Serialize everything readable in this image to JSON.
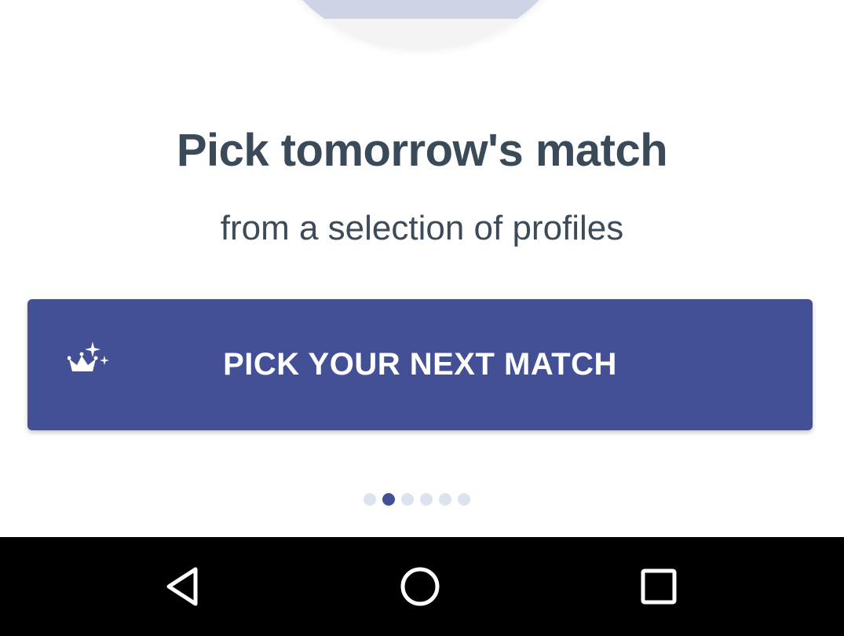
{
  "onboarding": {
    "title": "Pick tomorrow's match",
    "subtitle": "from a selection of profiles",
    "cta": {
      "label": "PICK YOUR NEXT MATCH",
      "icon": "crown-sparkle-icon"
    },
    "pagination": {
      "total": 6,
      "active_index": 1
    }
  },
  "system_nav": {
    "back_icon": "back-triangle-icon",
    "home_icon": "home-circle-icon",
    "recents_icon": "recents-square-icon"
  },
  "colors": {
    "primary": "#435095",
    "title_text": "#3a4a59",
    "dot_inactive": "#dde2ef",
    "nav_background": "#000000"
  }
}
